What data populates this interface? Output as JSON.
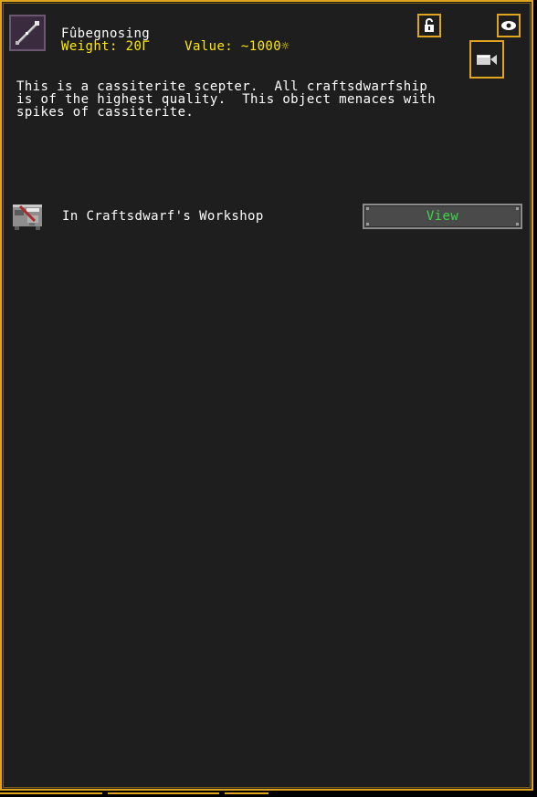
{
  "item": {
    "name": "Fûbegnosing",
    "weight": "Weight: 20Γ",
    "value": "Value: ~1000☼",
    "icon": "scepter-icon"
  },
  "toolbar": {
    "lock_icon": "unlock-icon",
    "eye_icon": "eye-icon",
    "camera_icon": "camera-icon"
  },
  "description": {
    "lines": [
      "This is a cassiterite scepter.  All craftsdwarfship",
      "is of the highest quality.  This object menaces with",
      "spikes of cassiterite."
    ]
  },
  "location": {
    "icon": "workshop-icon",
    "text": "In Craftsdwarf's Workshop",
    "button_label": "View"
  },
  "colors": {
    "frame_border": "#e0a41e",
    "background": "#1e1e1e",
    "stats_text": "#ffea00",
    "button_text": "#3cd64a"
  }
}
